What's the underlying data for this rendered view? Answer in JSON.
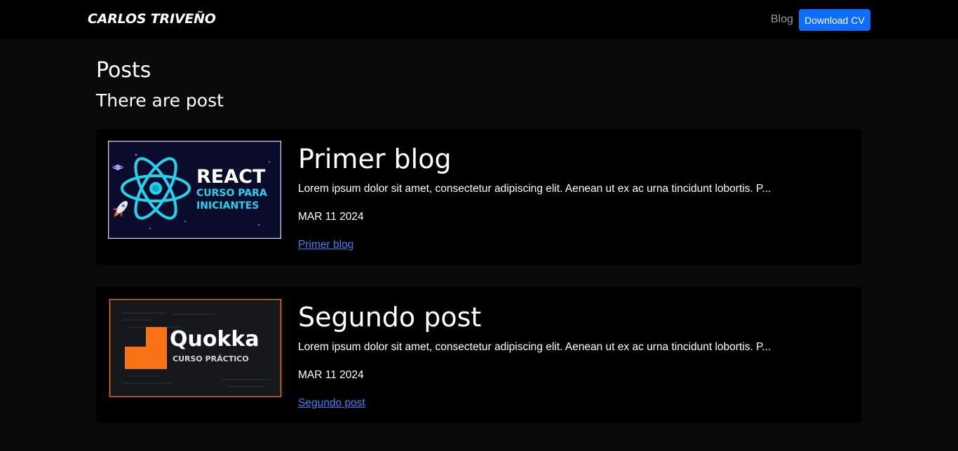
{
  "navbar": {
    "brand": "CARLOS TRIVEÑO",
    "blog_link": "Blog",
    "download_cv": "Download CV"
  },
  "page": {
    "title": "Posts",
    "subtitle": "There are post"
  },
  "posts": [
    {
      "title": "Primer blog",
      "excerpt": "Lorem ipsum dolor sit amet, consectetur adipiscing elit. Aenean ut ex ac urna tincidunt lobortis. P...",
      "date": "MAR 11 2024",
      "link": "Primer blog",
      "thumbnail": {
        "line1": "REACT",
        "line2": "CURSO PARA",
        "line3": "INICIANTES",
        "accent": "#22d3ee",
        "background": "#0b0b2b"
      }
    },
    {
      "title": "Segundo post",
      "excerpt": "Lorem ipsum dolor sit amet, consectetur adipiscing elit. Aenean ut ex ac urna tincidunt lobortis. P...",
      "date": "MAR 11 2024",
      "link": "Segundo post",
      "thumbnail": {
        "line1": "Quokka",
        "line2": "CURSO PRÁCTICO",
        "accent": "#f97316",
        "background": "#16181c"
      }
    }
  ],
  "colors": {
    "primary_button": "#0d6efd",
    "link": "#3b82f6",
    "page_background": "#0a0a0a",
    "card_background": "#000000"
  }
}
